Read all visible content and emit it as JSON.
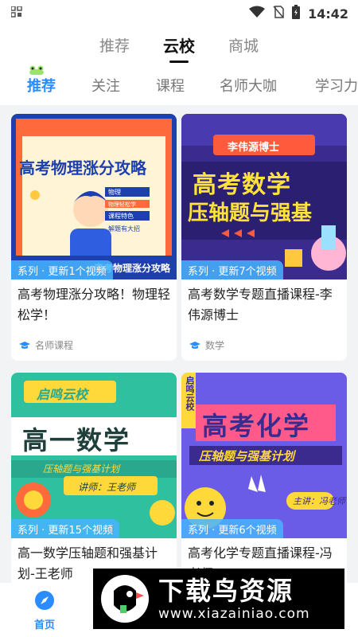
{
  "status_bar": {
    "time": "14:42",
    "icons": [
      "apps-icon",
      "wifi-icon",
      "no-sim-icon",
      "battery-icon"
    ]
  },
  "top_tabs": [
    {
      "label": "推荐",
      "active": false
    },
    {
      "label": "云校",
      "active": true
    },
    {
      "label": "商城",
      "active": false
    }
  ],
  "sub_tabs": [
    {
      "label": "推荐",
      "active": true
    },
    {
      "label": "关注",
      "active": false
    },
    {
      "label": "课程",
      "active": false
    },
    {
      "label": "名师大咖",
      "active": false
    },
    {
      "label": "学习力",
      "active": false
    }
  ],
  "cards": [
    {
      "badge": "系列 · 更新1个视频",
      "title": "高考物理涨分攻略！物理轻松学！",
      "meta": "名师课程",
      "thumb": {
        "main_text": "高考物理涨分攻略",
        "bullets": [
          "物理",
          "物理轻松学",
          "课程特色",
          "解题有大招"
        ],
        "strip": "高考物理涨分攻略",
        "bg": "#ff6a3d"
      }
    },
    {
      "badge": "系列 · 更新7个视频",
      "title": "高考数学专题直播课程-李伟源博士",
      "meta": "数学",
      "thumb": {
        "tag": "李伟源博士",
        "line1": "高考数学",
        "line2": "压轴题与强基",
        "bg": "#3b2b8f"
      }
    },
    {
      "badge": "系列 · 更新15个视频",
      "title": "高一数学压轴题和强基计划-王老师",
      "meta": "",
      "thumb": {
        "tag": "启鸣云校",
        "main": "高一数学",
        "sub": "压轴题与强基计划",
        "teacher": "讲师：王老师",
        "bg": "#2fc0a0"
      }
    },
    {
      "badge": "系列 · 更新6个视频",
      "title": "高考化学专题直播课程-冯老师",
      "meta": "",
      "thumb": {
        "tag": "启鸣云校",
        "main": "高考化学",
        "sub": "压轴题与强基计划",
        "teacher": "主讲：冯老师",
        "bg": "#6b5ce7"
      }
    }
  ],
  "tab_bar": {
    "home_label": "首页"
  },
  "watermark": {
    "cn": "下载鸟资源",
    "url": "www.xiazainiao.com"
  }
}
